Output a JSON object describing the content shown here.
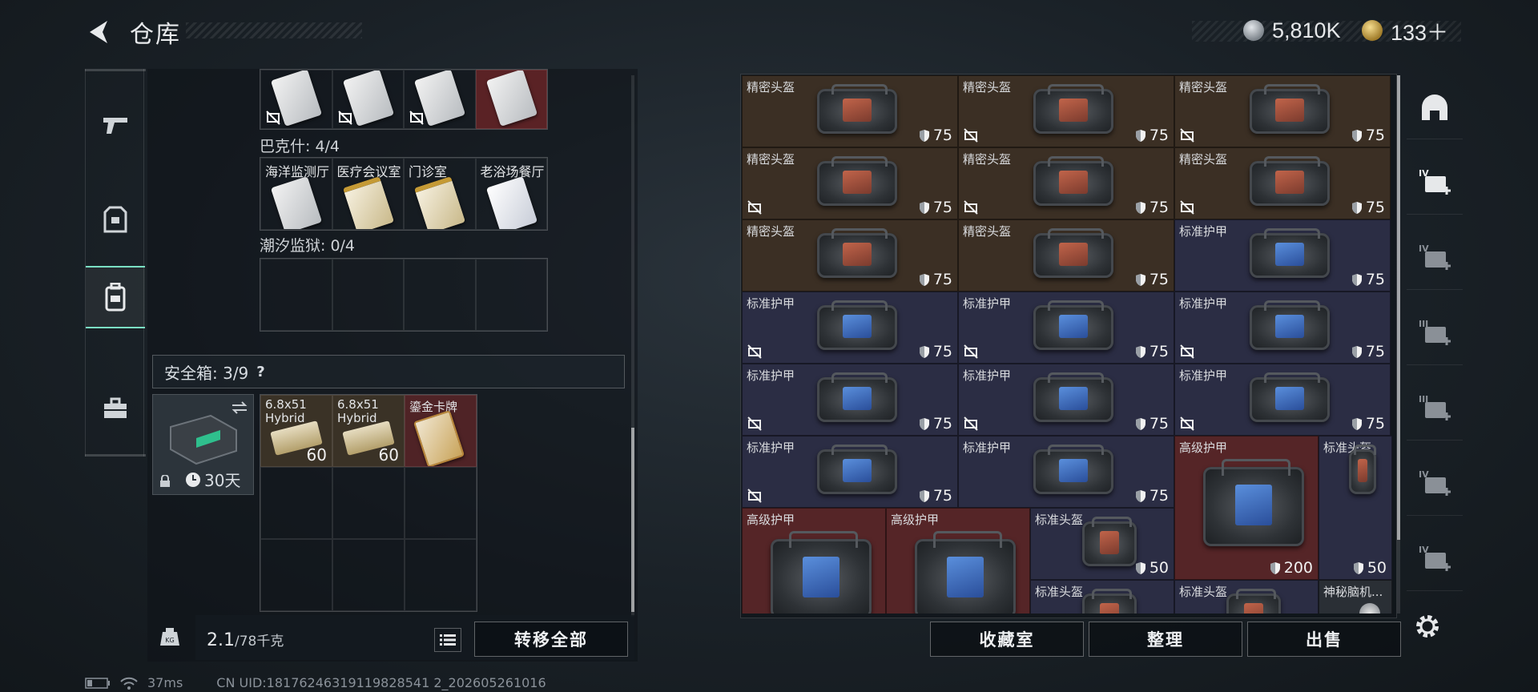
{
  "header": {
    "title": "仓库",
    "currency_silver": "5,810K",
    "currency_gold": "133＋"
  },
  "left_nav": [
    {
      "icon": "pistol-icon"
    },
    {
      "icon": "armor-vest-icon"
    },
    {
      "icon": "backpack-icon",
      "active": true
    },
    {
      "icon": "toolbox-icon"
    }
  ],
  "keycards": {
    "top_row": [
      {
        "style": "white"
      },
      {
        "style": "white"
      },
      {
        "style": "white"
      },
      {
        "style": "white",
        "bg": "red"
      }
    ],
    "bakshi_label": "巴克什: 4/4",
    "bakshi_cards": [
      {
        "name": "海洋监测厅",
        "style": "white"
      },
      {
        "name": "医疗会议室",
        "style": "gold"
      },
      {
        "name": "门诊室",
        "style": "gold"
      },
      {
        "name": "老浴场餐厅",
        "style": "pearl"
      }
    ],
    "tide_label": "潮汐监狱: 0/4"
  },
  "safe": {
    "label": "安全箱: 3/9",
    "help": "?",
    "timer": "30天",
    "items": [
      {
        "name": "6.8x51\nHybrid",
        "count": "60",
        "type": "ammo"
      },
      {
        "name": "6.8x51\nHybrid",
        "count": "60",
        "type": "ammo"
      },
      {
        "name": "鎏金卡牌",
        "count": "",
        "type": "card"
      }
    ]
  },
  "weight": {
    "current": "2.1",
    "max": "/78千克"
  },
  "buttons": {
    "transfer_all": "转移全部",
    "collection": "收藏室",
    "sort": "整理",
    "sell": "出售"
  },
  "status_bar": {
    "ping": "37ms",
    "uid": "CN UID:18176246319119828541 2_202605261016"
  },
  "stash_items": [
    {
      "label": "精密头盔",
      "value": "75",
      "color": "brown",
      "bag": "orange",
      "nodrop": false
    },
    {
      "label": "精密头盔",
      "value": "75",
      "color": "brown",
      "bag": "orange",
      "nodrop": true
    },
    {
      "label": "精密头盔",
      "value": "75",
      "color": "brown",
      "bag": "orange",
      "nodrop": true
    },
    {
      "label": "精密头盔",
      "value": "75",
      "color": "brown",
      "bag": "orange",
      "nodrop": true
    },
    {
      "label": "精密头盔",
      "value": "75",
      "color": "brown",
      "bag": "orange",
      "nodrop": true
    },
    {
      "label": "精密头盔",
      "value": "75",
      "color": "brown",
      "bag": "orange",
      "nodrop": true
    },
    {
      "label": "精密头盔",
      "value": "75",
      "color": "brown",
      "bag": "orange",
      "nodrop": false
    },
    {
      "label": "精密头盔",
      "value": "75",
      "color": "brown",
      "bag": "orange",
      "nodrop": false
    },
    {
      "label": "标准护甲",
      "value": "75",
      "color": "blue",
      "bag": "bluep",
      "nodrop": false
    },
    {
      "label": "标准护甲",
      "value": "75",
      "color": "blue",
      "bag": "bluep",
      "nodrop": true
    },
    {
      "label": "标准护甲",
      "value": "75",
      "color": "blue",
      "bag": "bluep",
      "nodrop": true
    },
    {
      "label": "标准护甲",
      "value": "75",
      "color": "blue",
      "bag": "bluep",
      "nodrop": true
    },
    {
      "label": "标准护甲",
      "value": "75",
      "color": "blue",
      "bag": "bluep",
      "nodrop": true
    },
    {
      "label": "标准护甲",
      "value": "75",
      "color": "blue",
      "bag": "bluep",
      "nodrop": true
    },
    {
      "label": "标准护甲",
      "value": "75",
      "color": "blue",
      "bag": "bluep",
      "nodrop": true
    },
    {
      "label": "标准护甲",
      "value": "75",
      "color": "blue",
      "bag": "bluep",
      "nodrop": true
    },
    {
      "label": "标准护甲",
      "value": "75",
      "color": "blue",
      "bag": "bluep",
      "nodrop": false
    }
  ],
  "stash_large": [
    {
      "label": "高级护甲",
      "value": "200",
      "color": "red",
      "bag": "bluep"
    },
    {
      "label": "标准头盔",
      "value": "50",
      "color": "blue",
      "bag": "orange"
    },
    {
      "label": "高级护甲",
      "value": "",
      "color": "red",
      "bag": "bluep"
    },
    {
      "label": "高级护甲",
      "value": "",
      "color": "red",
      "bag": "bluep"
    },
    {
      "label": "标准头盔",
      "value": "50",
      "color": "blue",
      "bag": "orange"
    },
    {
      "label": "标准头盔",
      "value": "",
      "color": "blue",
      "bag": "orange"
    },
    {
      "label": "标准头盔",
      "value": "",
      "color": "blue",
      "bag": "orange"
    },
    {
      "label": "神秘脑机...",
      "value": "",
      "color": "gray",
      "bag": "none"
    }
  ],
  "right_nav": [
    {
      "icon": "helmet-icon"
    },
    {
      "icon": "med-kit-iv-icon",
      "badge": "IV"
    },
    {
      "icon": "camera-iv-icon",
      "badge": "IV"
    },
    {
      "icon": "chart-iii-icon",
      "badge": "III"
    },
    {
      "icon": "weapon-iii-icon",
      "badge": "III"
    },
    {
      "icon": "folder-iv-icon",
      "badge": "IV"
    },
    {
      "icon": "med-kit-iv-2-icon",
      "badge": "IV"
    }
  ]
}
